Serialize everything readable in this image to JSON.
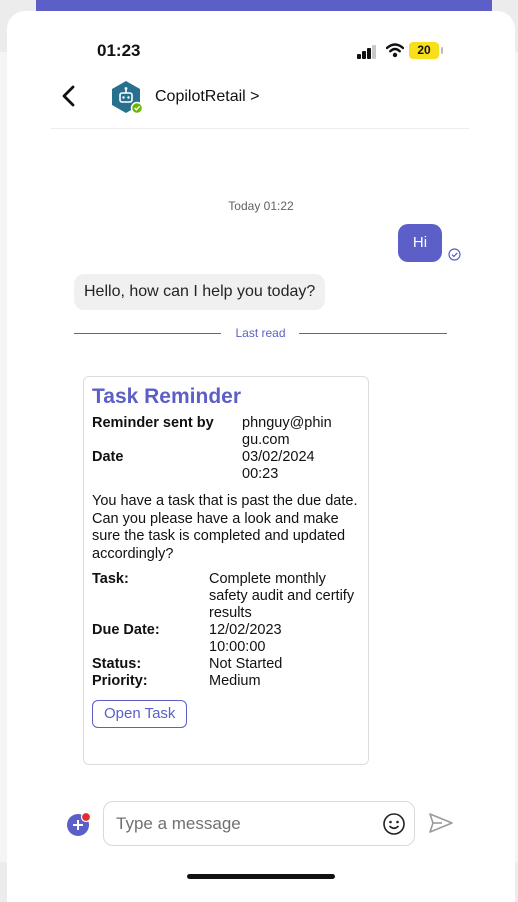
{
  "status_bar": {
    "time": "01:23",
    "battery": "20"
  },
  "header": {
    "bot_name": "CopilotRetail >"
  },
  "chat": {
    "timestamp": "Today 01:22",
    "outgoing_message": "Hi",
    "incoming_message": "Hello, how can I help you today?",
    "last_read_label": "Last read"
  },
  "card": {
    "title": "Task Reminder",
    "reminder_sent_by_label": "Reminder sent by",
    "reminder_sent_by_value": "phnguy@phin gu.com",
    "date_label": "Date",
    "date_value": "03/02/2024 00:23",
    "message": "You have a task that is past the due date. Can you please have a look and make sure the task is completed and updated accordingly?",
    "task_label": "Task:",
    "task_value": "Complete monthly safety audit and certify results",
    "due_date_label": "Due Date:",
    "due_date_value": "12/02/2023 10:00:00",
    "status_label": "Status:",
    "status_value": "Not Started",
    "priority_label": "Priority:",
    "priority_value": "Medium",
    "open_task_label": "Open Task"
  },
  "compose": {
    "placeholder": "Type a message"
  },
  "colors": {
    "accent": "#5b5fc7",
    "battery": "#f7e01b",
    "online": "#6bb700"
  }
}
